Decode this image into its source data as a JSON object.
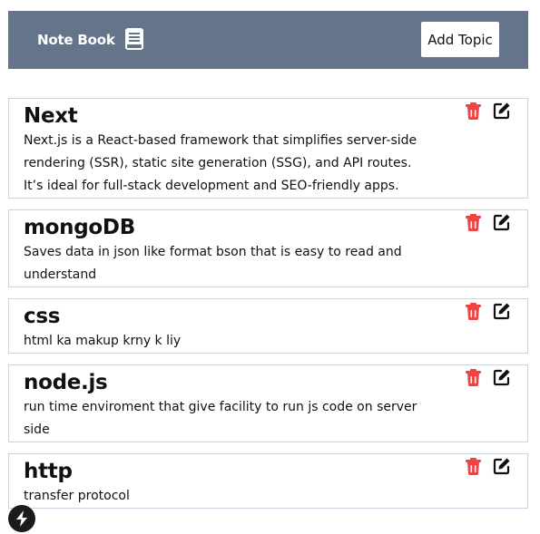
{
  "navbar": {
    "brand": "Note Book",
    "brand_icon": "book-icon",
    "add_button": "Add Topic",
    "bg_color": "#64748b"
  },
  "topics": [
    {
      "title": "Next",
      "description": "Next.js is a React-based framework that simplifies server-side rendering (SSR), static site generation (SSG), and API routes. It’s ideal for full-stack development and SEO-friendly apps."
    },
    {
      "title": "mongoDB",
      "description": "Saves data in json like format bson that is easy to read and understand"
    },
    {
      "title": "css",
      "description": "html ka makup krny k liy"
    },
    {
      "title": "node.js",
      "description": "run time enviroment that give facility to run js code on server side"
    },
    {
      "title": "http",
      "description": "transfer protocol"
    }
  ],
  "icons": {
    "delete": "trash-icon",
    "edit": "edit-icon",
    "dev_badge": "nextjs-logo-icon"
  },
  "colors": {
    "delete": "#ef4444",
    "border": "#cbd5e1"
  }
}
